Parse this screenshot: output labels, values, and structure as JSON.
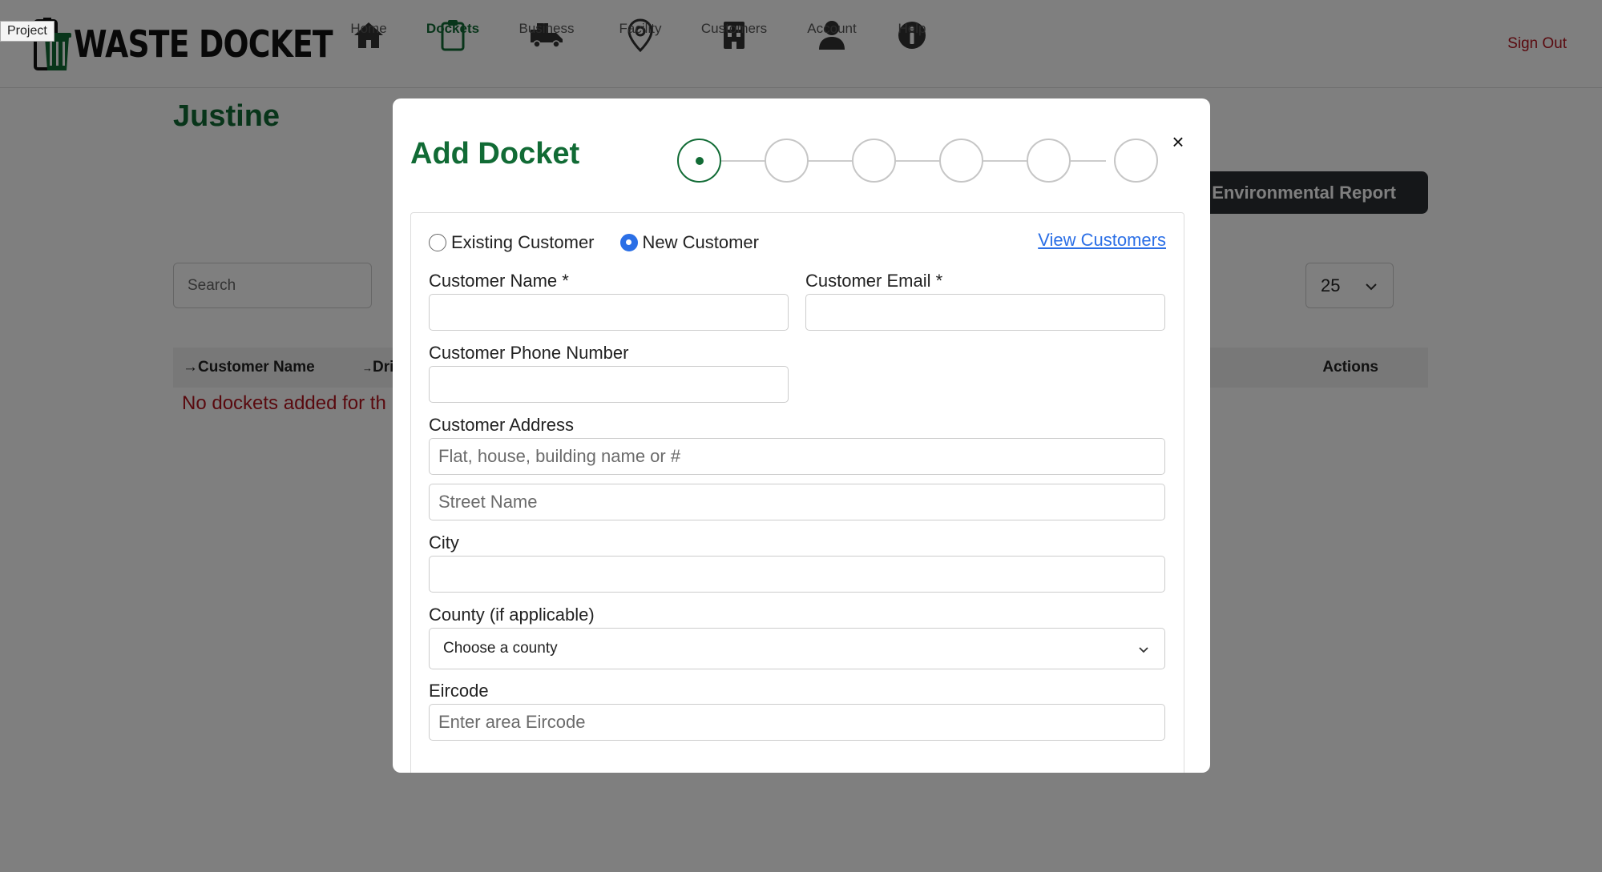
{
  "app": {
    "project_tag": "Project",
    "logo_text": "WASTE DOCKET",
    "sign_out": "Sign Out"
  },
  "nav": {
    "items": [
      {
        "label": "Home",
        "icon": "home-icon"
      },
      {
        "label": "Dockets",
        "icon": "clipboard-icon",
        "active": true
      },
      {
        "label": "Business",
        "icon": "truck-icon"
      },
      {
        "label": "Facility",
        "icon": "map-pin-icon"
      },
      {
        "label": "Customers",
        "icon": "building-icon"
      },
      {
        "label": "Account",
        "icon": "user-icon"
      },
      {
        "label": "Help",
        "icon": "info-icon"
      }
    ]
  },
  "page": {
    "title": "Justine",
    "environmental_report": "Environmental Report",
    "search_placeholder": "Search",
    "page_size": "25",
    "table": {
      "col_customer_name": "Customer Name",
      "col_driver": "Dri",
      "col_actions": "Actions"
    },
    "empty_message": "No dockets added for th"
  },
  "modal": {
    "title": "Add Docket",
    "close": "×",
    "steps": 6,
    "current_step": 1,
    "customer_type": {
      "existing": "Existing Customer",
      "new": "New Customer",
      "selected": "new"
    },
    "view_customers": "View Customers",
    "fields": {
      "customer_name_label": "Customer Name *",
      "customer_name_value": "",
      "customer_email_label": "Customer Email *",
      "customer_email_value": "",
      "phone_label": "Customer Phone Number",
      "phone_value": "",
      "address_label": "Customer Address",
      "address1_placeholder": "Flat, house, building name or #",
      "address2_placeholder": "Street Name",
      "city_label": "City",
      "city_value": "",
      "county_label": "County (if applicable)",
      "county_selected": "Choose a county",
      "eircode_label": "Eircode",
      "eircode_placeholder": "Enter area Eircode"
    }
  },
  "colors": {
    "brand_green": "#116b35",
    "sign_out_red": "#b3121d",
    "link_blue": "#2b6fe6"
  }
}
